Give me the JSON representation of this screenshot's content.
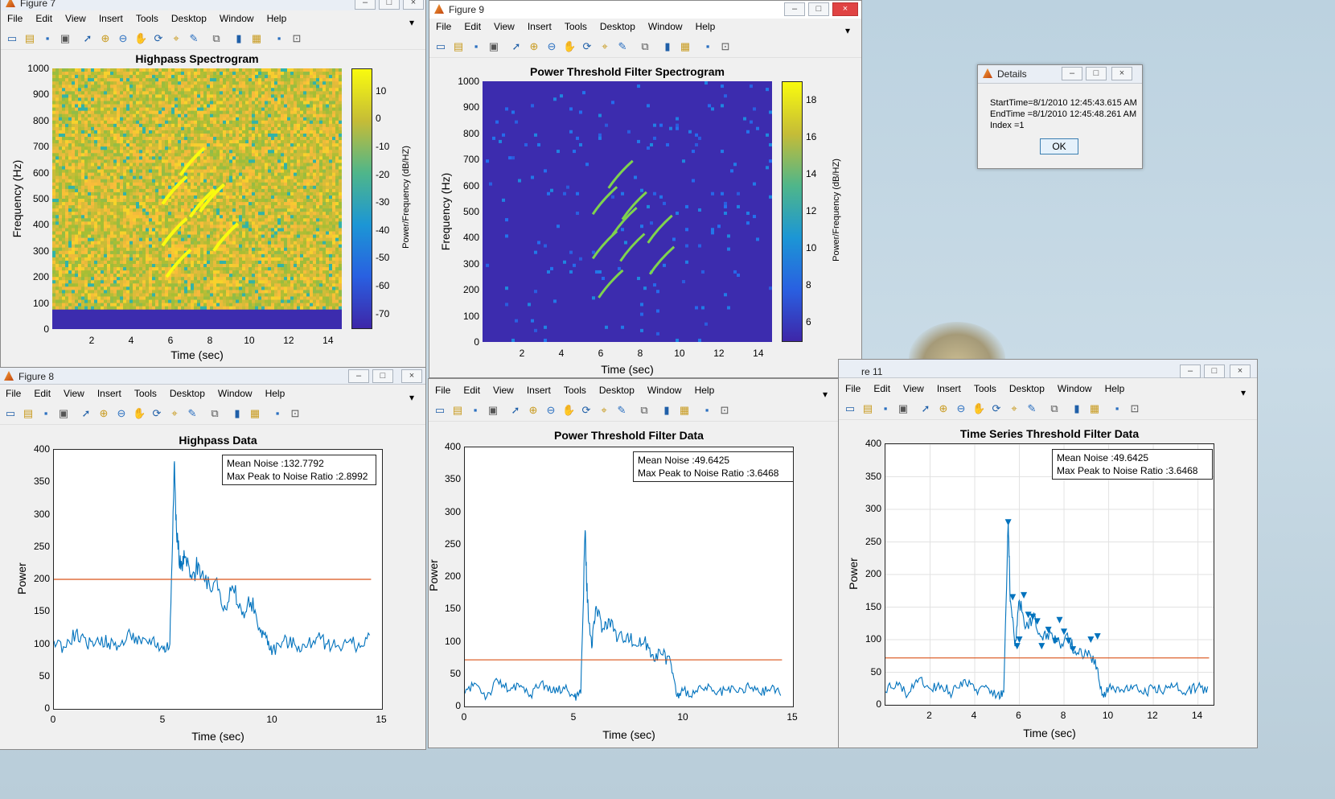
{
  "menu_items": [
    "File",
    "Edit",
    "View",
    "Insert",
    "Tools",
    "Desktop",
    "Window",
    "Help"
  ],
  "window_titles": {
    "fig7": "Figure 7",
    "fig9": "Figure 9",
    "fig8": "Figure 8",
    "fig11": "re 11",
    "details": "Details"
  },
  "details_dialog": {
    "line1": "StartTime=8/1/2010 12:45:43.615 AM",
    "line2": "EndTime =8/1/2010 12:45:48.261 AM",
    "line3": "Index =1",
    "ok_label": "OK"
  },
  "colors": {
    "series": "#0072bd",
    "threshold": "#d95319",
    "parula_low": "#3e26a8",
    "parula_high": "#f9fb0e"
  },
  "icons": [
    "new-file-icon",
    "open-icon",
    "save-icon",
    "print-icon",
    "pointer-icon",
    "zoom-in-icon",
    "zoom-out-icon",
    "pan-icon",
    "rotate-icon",
    "data-cursor-icon",
    "brush-icon",
    "link-icon",
    "colorbar-icon",
    "legend-icon",
    "hide-plot-tools-icon",
    "show-plot-tools-icon"
  ],
  "chart_data": [
    {
      "id": "highpass_spectrogram",
      "type": "heatmap",
      "title": "Highpass Spectrogram",
      "xlabel": "Time (sec)",
      "ylabel": "Frequency (Hz)",
      "xlim": [
        0,
        14.7
      ],
      "ylim": [
        0,
        1000
      ],
      "xticks": [
        "2",
        "4",
        "6",
        "8",
        "10",
        "12",
        "14"
      ],
      "yticks": [
        "0",
        "100",
        "200",
        "300",
        "400",
        "500",
        "600",
        "700",
        "800",
        "900",
        "1000"
      ],
      "colorbar": {
        "label": "Power/Frequency (dB/HZ)",
        "ticks": [
          "10",
          "0",
          "-10",
          "-20",
          "-30",
          "-40",
          "-50",
          "-60",
          "-70"
        ],
        "range": [
          -75,
          18
        ]
      },
      "cutoff_hz": 75,
      "tracks": [
        [
          5.6,
          480
        ],
        [
          6.5,
          590
        ],
        [
          5.6,
          320
        ],
        [
          7.0,
          430
        ],
        [
          7.5,
          450
        ],
        [
          5.8,
          200
        ],
        [
          8.2,
          300
        ]
      ]
    },
    {
      "id": "power_threshold_spectrogram",
      "type": "heatmap",
      "title": "Power Threshold Filter Spectrogram",
      "xlabel": "Time (sec)",
      "ylabel": "Frequency (Hz)",
      "xlim": [
        0,
        14.7
      ],
      "ylim": [
        0,
        1000
      ],
      "xticks": [
        "2",
        "4",
        "6",
        "8",
        "10",
        "12",
        "14"
      ],
      "yticks": [
        "0",
        "100",
        "200",
        "300",
        "400",
        "500",
        "600",
        "700",
        "800",
        "900",
        "1000"
      ],
      "colorbar": {
        "label": "Power/Frequency (dB/HZ)",
        "ticks": [
          "18",
          "16",
          "14",
          "12",
          "10",
          "8",
          "6"
        ],
        "range": [
          5,
          19
        ]
      },
      "tracks": [
        [
          5.6,
          490
        ],
        [
          6.4,
          590
        ],
        [
          5.6,
          320
        ],
        [
          6.6,
          410
        ],
        [
          7.1,
          470
        ],
        [
          8.4,
          380
        ],
        [
          7.0,
          310
        ],
        [
          5.9,
          170
        ],
        [
          8.5,
          260
        ]
      ]
    },
    {
      "id": "highpass_data",
      "type": "line",
      "title": "Highpass Data",
      "xlabel": "Time (sec)",
      "ylabel": "Power",
      "xlim": [
        0,
        15
      ],
      "ylim": [
        0,
        400
      ],
      "xticks": [
        "0",
        "5",
        "10",
        "15"
      ],
      "yticks": [
        "0",
        "50",
        "100",
        "150",
        "200",
        "250",
        "300",
        "350",
        "400"
      ],
      "threshold": 200,
      "legend": [
        "Mean Noise :132.7792",
        "Max Peak to Noise Ratio :2.8992"
      ],
      "series": [
        {
          "x": [
            0,
            0.5,
            1,
            1.5,
            2,
            2.5,
            3,
            3.5,
            4,
            4.5,
            5,
            5.3,
            5.5,
            5.6,
            5.8,
            6,
            6.3,
            6.6,
            7,
            7.4,
            7.8,
            8.2,
            8.6,
            9,
            9.4,
            9.7,
            10,
            10.5,
            11,
            11.5,
            12,
            12.5,
            13,
            13.5,
            14,
            14.5
          ],
          "y": [
            105,
            95,
            118,
            98,
            110,
            102,
            96,
            115,
            100,
            108,
            92,
            100,
            378,
            280,
            215,
            235,
            200,
            225,
            185,
            200,
            160,
            185,
            145,
            165,
            125,
            110,
            90,
            105,
            100,
            95,
            110,
            100,
            98,
            105,
            95,
            110
          ]
        }
      ]
    },
    {
      "id": "power_threshold_data",
      "type": "line",
      "title": "Power Threshold Filter Data",
      "xlabel": "Time (sec)",
      "ylabel": "Power",
      "xlim": [
        0,
        15
      ],
      "ylim": [
        0,
        400
      ],
      "xticks": [
        "0",
        "5",
        "10",
        "15"
      ],
      "yticks": [
        "0",
        "50",
        "100",
        "150",
        "200",
        "250",
        "300",
        "350",
        "400"
      ],
      "threshold": 72,
      "legend": [
        "Mean Noise :49.6425",
        "Max Peak to Noise Ratio :3.6468"
      ],
      "series": [
        {
          "x": [
            0,
            0.5,
            1,
            1.5,
            2,
            2.5,
            3,
            3.5,
            4,
            4.5,
            5,
            5.3,
            5.5,
            5.6,
            5.8,
            6,
            6.3,
            6.6,
            7,
            7.4,
            7.8,
            8.2,
            8.6,
            9,
            9.4,
            9.7,
            10,
            10.5,
            11,
            11.5,
            12,
            12.5,
            13,
            13.5,
            14,
            14.5
          ],
          "y": [
            20,
            35,
            15,
            40,
            25,
            30,
            18,
            38,
            22,
            30,
            15,
            20,
            272,
            160,
            90,
            155,
            120,
            135,
            105,
            110,
            95,
            100,
            80,
            80,
            70,
            15,
            25,
            20,
            30,
            18,
            25,
            22,
            30,
            20,
            28,
            22
          ]
        }
      ]
    },
    {
      "id": "time_series_threshold_data",
      "type": "line",
      "title": "Time Series Threshold Filter Data",
      "xlabel": "Time (sec)",
      "ylabel": "Power",
      "xlim": [
        0,
        14.7
      ],
      "ylim": [
        0,
        400
      ],
      "xticks": [
        "2",
        "4",
        "6",
        "8",
        "10",
        "12",
        "14"
      ],
      "yticks": [
        "0",
        "50",
        "100",
        "150",
        "200",
        "250",
        "300",
        "350",
        "400"
      ],
      "grid": true,
      "threshold": 72,
      "legend": [
        "Mean Noise :49.6425",
        "Max Peak to Noise Ratio :3.6468"
      ],
      "series": [
        {
          "x": [
            0,
            0.5,
            1,
            1.5,
            2,
            2.5,
            3,
            3.5,
            4,
            4.5,
            5,
            5.3,
            5.5,
            5.6,
            5.8,
            6,
            6.3,
            6.6,
            7,
            7.4,
            7.8,
            8.2,
            8.6,
            9,
            9.4,
            9.7,
            10,
            10.5,
            11,
            11.5,
            12,
            12.5,
            13,
            13.5,
            14,
            14.5
          ],
          "y": [
            20,
            35,
            15,
            40,
            25,
            30,
            18,
            38,
            22,
            30,
            15,
            20,
            280,
            160,
            90,
            160,
            120,
            135,
            105,
            110,
            95,
            100,
            80,
            80,
            70,
            15,
            25,
            20,
            30,
            18,
            25,
            22,
            30,
            20,
            28,
            22
          ]
        }
      ],
      "peaks": {
        "x": [
          5.5,
          5.7,
          5.9,
          6.0,
          6.2,
          6.4,
          6.6,
          6.8,
          7.0,
          7.3,
          7.6,
          7.8,
          8.0,
          8.2,
          8.4,
          9.2,
          9.5
        ],
        "y": [
          280,
          165,
          90,
          100,
          168,
          138,
          135,
          128,
          90,
          115,
          98,
          130,
          112,
          98,
          85,
          100,
          105
        ]
      }
    }
  ]
}
